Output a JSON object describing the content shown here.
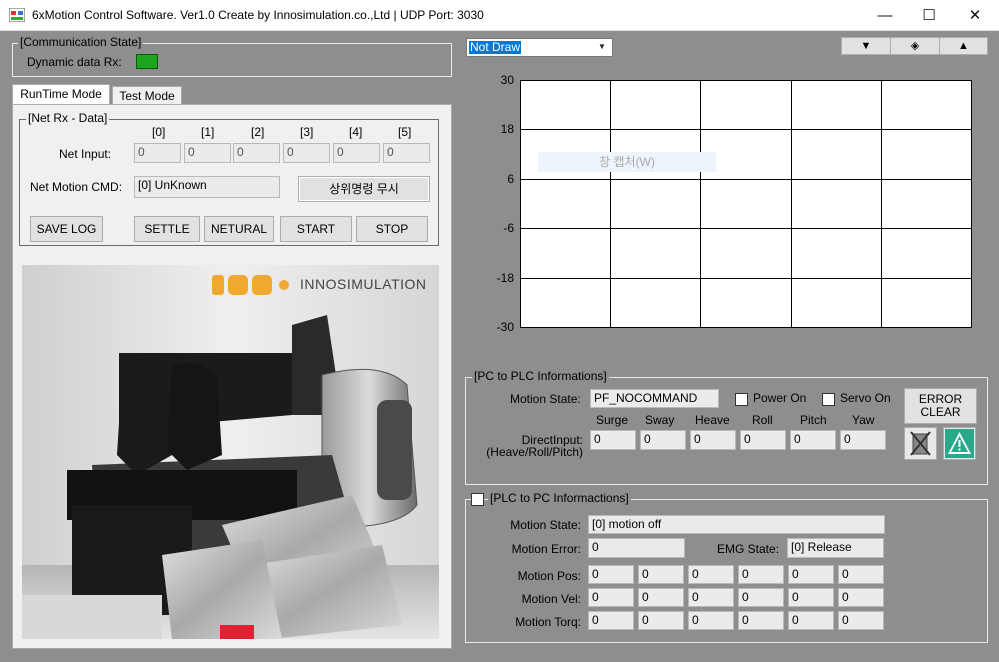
{
  "window": {
    "title": "6xMotion Control Software.  Ver1.0  Create by Innosimulation.co.,Ltd    |  UDP Port: 3030",
    "minimize": "—",
    "maximize": "☐",
    "close": "✕"
  },
  "communication": {
    "group_title": "[Communication State]",
    "dynamic_rx_label": "Dynamic data Rx:",
    "indicator_color": "#1aa51a"
  },
  "tabs": [
    "RunTime Mode",
    "Test Mode"
  ],
  "net_rx": {
    "group_title": "[Net Rx - Data]",
    "index_headers": [
      "[0]",
      "[1]",
      "[2]",
      "[3]",
      "[4]",
      "[5]"
    ],
    "net_input_label": "Net Input:",
    "net_input_values": [
      "0",
      "0",
      "0",
      "0",
      "0",
      "0"
    ],
    "motion_cmd_label": "Net Motion CMD:",
    "motion_cmd_value": "[0] UnKnown",
    "ignore_button": "상위명령 무시",
    "buttons": {
      "save_log": "SAVE LOG",
      "settle": "SETTLE",
      "neutral": "NETURAL",
      "start": "START",
      "stop": "STOP"
    }
  },
  "photo": {
    "brand_text": "INNOSIMULATION",
    "brand_color": "#f0a830"
  },
  "graph": {
    "dropdown_value": "Not Draw",
    "btn_down": "▼",
    "btn_mid": "◈",
    "btn_up": "▲",
    "watermark": "창 캡처(W)"
  },
  "chart_data": {
    "type": "line",
    "series": [],
    "y_ticks": [
      "30",
      "18",
      "6",
      "-6",
      "-18",
      "-30"
    ],
    "ylim": [
      -30,
      30
    ],
    "grid": true,
    "x_divisions": 5
  },
  "pc_to_plc": {
    "group_title": "[PC to PLC Informations]",
    "motion_state_label": "Motion State:",
    "motion_state_value": "PF_NOCOMMAND",
    "power_on_label": "Power On",
    "servo_on_label": "Servo On",
    "error_clear": [
      "ERROR",
      "CLEAR"
    ],
    "axis_headers": [
      "Surge",
      "Sway",
      "Heave",
      "Roll",
      "Pitch",
      "Yaw"
    ],
    "direct_input_label_1": "DirectInput:",
    "direct_input_label_2": "(Heave/Roll/Pitch)",
    "direct_input_values": [
      "0",
      "0",
      "0",
      "0",
      "0",
      "0"
    ]
  },
  "plc_to_pc": {
    "group_title": "[PLC to PC Informactions]",
    "motion_state_label": "Motion State:",
    "motion_state_value": "[0] motion off",
    "motion_error_label": "Motion Error:",
    "motion_error_value": "0",
    "emg_state_label": "EMG State:",
    "emg_state_value": "[0] Release",
    "motion_pos_label": "Motion Pos:",
    "motion_pos_values": [
      "0",
      "0",
      "0",
      "0",
      "0",
      "0"
    ],
    "motion_vel_label": "Motion Vel:",
    "motion_vel_values": [
      "0",
      "0",
      "0",
      "0",
      "0",
      "0"
    ],
    "motion_torq_label": "Motion Torq:",
    "motion_torq_values": [
      "0",
      "0",
      "0",
      "0",
      "0",
      "0"
    ]
  }
}
